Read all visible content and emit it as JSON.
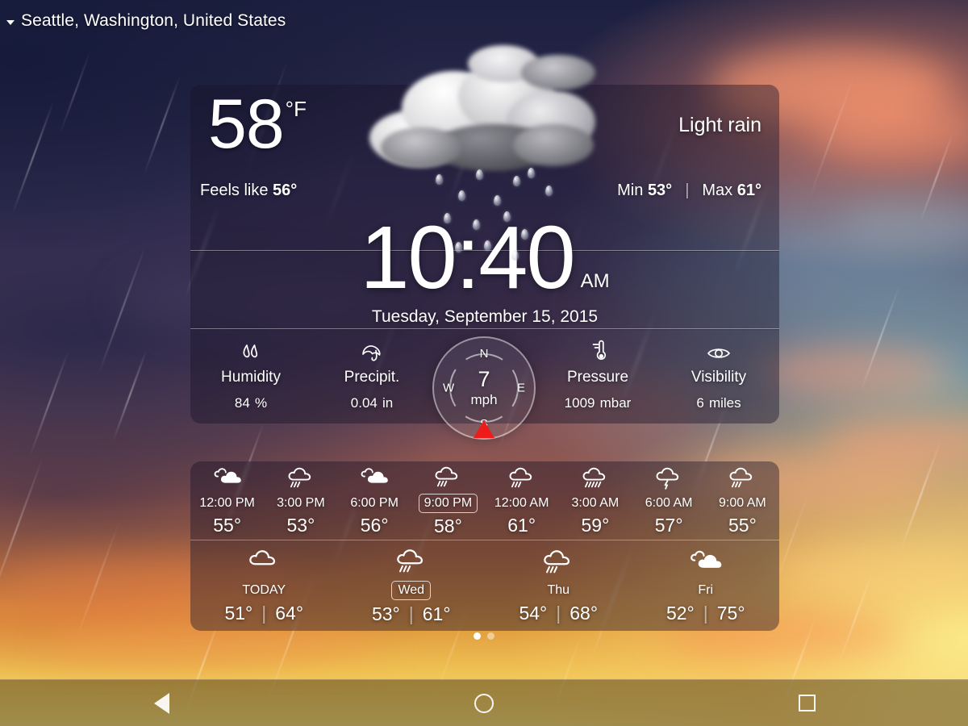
{
  "location": {
    "name": "Seattle, Washington, United States",
    "caret_icon": "chevron-down-icon"
  },
  "current": {
    "temperature": "58",
    "unit": "°F",
    "condition": "Light rain",
    "condition_icon": "rain-cloud-icon",
    "feels_like_label": "Feels like",
    "feels_like_value": "56°",
    "min_label": "Min",
    "min_value": "53°",
    "separator": "|",
    "max_label": "Max",
    "max_value": "61°"
  },
  "clock": {
    "time": "10:40",
    "meridiem": "AM",
    "date": "Tuesday, September 15, 2015"
  },
  "metrics": [
    {
      "icon": "humidity-drops-icon",
      "label": "Humidity",
      "value": "84",
      "unit": "%"
    },
    {
      "icon": "umbrella-icon",
      "label": "Precipit.",
      "value": "0.04",
      "unit": "in"
    },
    {
      "icon": "thermometer-icon",
      "label": "Pressure",
      "value": "1009",
      "unit": "mbar"
    },
    {
      "icon": "eye-icon",
      "label": "Visibility",
      "value": "6",
      "unit": "miles"
    }
  ],
  "wind": {
    "speed": "7",
    "unit": "mph",
    "north": "N",
    "east": "E",
    "south": "S",
    "west": "W",
    "pointer_icon": "wind-direction-pointer"
  },
  "hourly": [
    {
      "time": "12:00 PM",
      "temp": "55°",
      "icon": "partly-cloudy-icon",
      "active": false
    },
    {
      "time": "3:00 PM",
      "temp": "53°",
      "icon": "rain-cloud-icon",
      "active": false
    },
    {
      "time": "6:00 PM",
      "temp": "56°",
      "icon": "partly-cloudy-icon",
      "active": false
    },
    {
      "time": "9:00 PM",
      "temp": "58°",
      "icon": "rain-cloud-icon",
      "active": true
    },
    {
      "time": "12:00 AM",
      "temp": "61°",
      "icon": "rain-cloud-icon",
      "active": false
    },
    {
      "time": "3:00 AM",
      "temp": "59°",
      "icon": "heavy-rain-icon",
      "active": false
    },
    {
      "time": "6:00 AM",
      "temp": "57°",
      "icon": "thunderstorm-icon",
      "active": false
    },
    {
      "time": "9:00 AM",
      "temp": "55°",
      "icon": "rain-cloud-icon",
      "active": false
    }
  ],
  "daily": [
    {
      "name": "TODAY",
      "low": "51°",
      "high": "64°",
      "sep": "|",
      "icon": "cloud-icon",
      "active": false
    },
    {
      "name": "Wed",
      "low": "53°",
      "high": "61°",
      "sep": "|",
      "icon": "rain-cloud-icon",
      "active": true
    },
    {
      "name": "Thu",
      "low": "54°",
      "high": "68°",
      "sep": "|",
      "icon": "rain-cloud-icon",
      "active": false
    },
    {
      "name": "Fri",
      "low": "52°",
      "high": "75°",
      "sep": "|",
      "icon": "partly-cloudy-icon",
      "active": false
    }
  ],
  "pager": {
    "total": 2,
    "current": 1
  },
  "navbar": [
    {
      "icon": "back-triangle-icon",
      "label": "Back"
    },
    {
      "icon": "home-circle-icon",
      "label": "Home"
    },
    {
      "icon": "recents-square-icon",
      "label": "Recents"
    }
  ],
  "colors": {
    "pointer_red": "#ee1b1b",
    "text_white": "#ffffff",
    "card_overlay": "rgba(24,20,40,.42)",
    "sky_top": "#1d2040",
    "sky_bottom": "#f6e07c"
  }
}
